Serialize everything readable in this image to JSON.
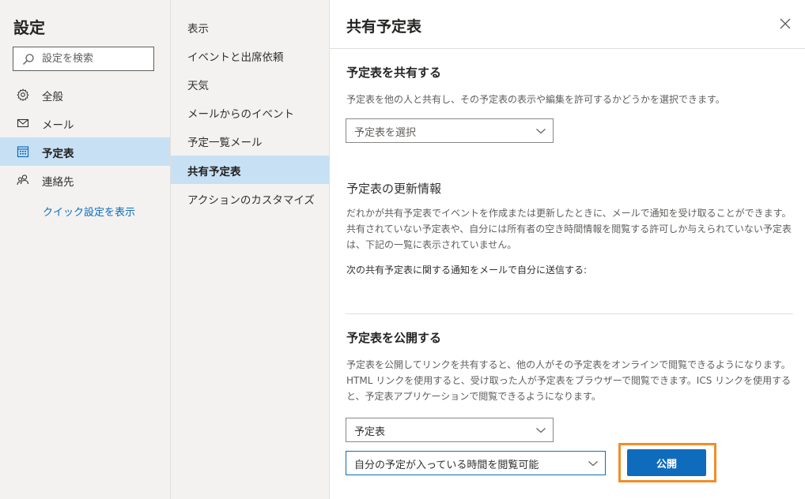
{
  "sidebar": {
    "title": "設定",
    "search_placeholder": "設定を検索",
    "items": [
      {
        "label": "全般",
        "icon": "gear-icon"
      },
      {
        "label": "メール",
        "icon": "mail-icon"
      },
      {
        "label": "予定表",
        "icon": "calendar-icon",
        "selected": true
      },
      {
        "label": "連絡先",
        "icon": "people-icon"
      }
    ],
    "quick_settings_link": "クイック設定を表示"
  },
  "subnav": {
    "items": [
      {
        "label": "表示"
      },
      {
        "label": "イベントと出席依頼"
      },
      {
        "label": "天気"
      },
      {
        "label": "メールからのイベント"
      },
      {
        "label": "予定一覧メール"
      },
      {
        "label": "共有予定表",
        "selected": true
      },
      {
        "label": "アクションのカスタマイズ"
      }
    ]
  },
  "content": {
    "title": "共有予定表",
    "share": {
      "heading": "予定表を共有する",
      "description": "予定表を他の人と共有し、その予定表の表示や編集を許可するかどうかを選択できます。",
      "dropdown_placeholder": "予定表を選択"
    },
    "updates": {
      "heading": "予定表の更新情報",
      "description": "だれかが共有予定表でイベントを作成または更新したときに、メールで通知を受け取ることができます。共有されていない予定表や、自分には所有者の空き時間情報を閲覧する許可しか与えられていない予定表は、下記の一覧に表示されていません。",
      "notify_text": "次の共有予定表に関する通知をメールで自分に送信する:"
    },
    "publish": {
      "heading": "予定表を公開する",
      "description": "予定表を公開してリンクを共有すると、他の人がその予定表をオンラインで閲覧できるようになります。HTML リンクを使用すると、受け取った人が予定表をブラウザーで閲覧できます。ICS リンクを使用すると、予定表アプリケーションで閲覧できるようになります。",
      "calendar_value": "予定表",
      "permission_value": "自分の予定が入っている時間を閲覧可能",
      "publish_button": "公開"
    }
  },
  "colors": {
    "accent": "#0f6cbd",
    "selected_background": "#c7e0f4",
    "pane_background": "#f3f2f1",
    "highlight": "#f28c28"
  }
}
